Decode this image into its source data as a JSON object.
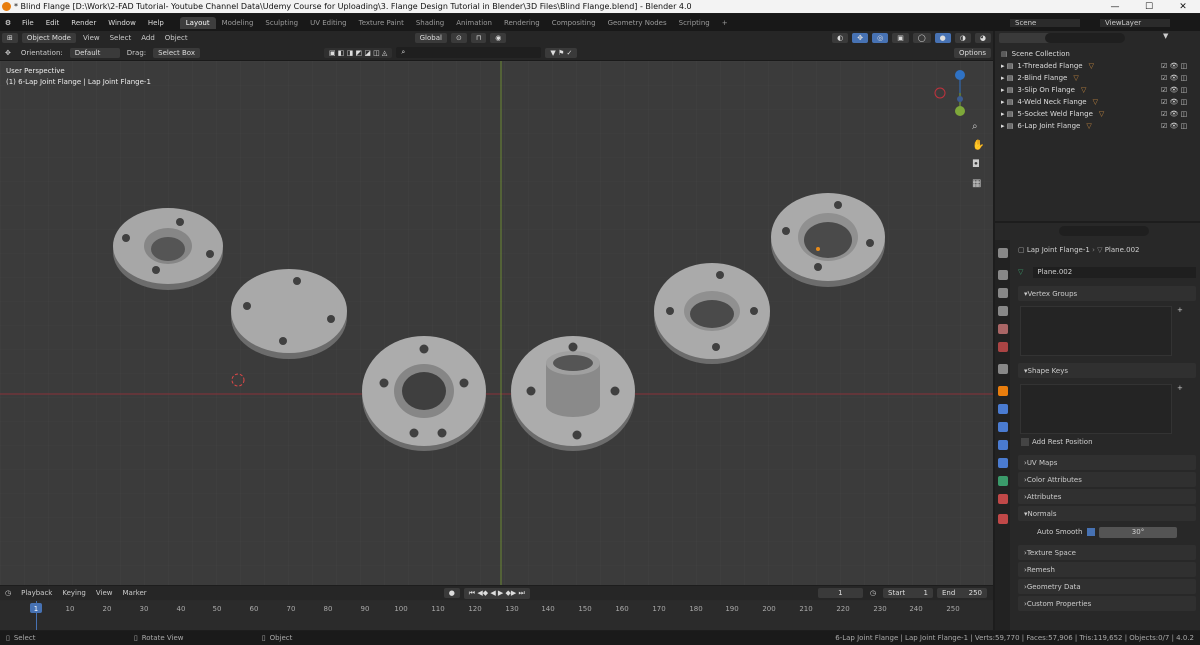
{
  "window": {
    "title": "* Blind Flange [D:\\Work\\2-FAD Tutorial- Youtube Channel Data\\Udemy Course for Uploading\\3. Flange Design Tutorial in Blender\\3D Files\\Blind Flange.blend] - Blender 4.0",
    "min": "—",
    "max": "☐",
    "close": "✕"
  },
  "menu": [
    "File",
    "Edit",
    "Render",
    "Window",
    "Help"
  ],
  "workspaces": [
    "Layout",
    "Modeling",
    "Sculpting",
    "UV Editing",
    "Texture Paint",
    "Shading",
    "Animation",
    "Rendering",
    "Compositing",
    "Geometry Nodes",
    "Scripting",
    "+"
  ],
  "scene": "Scene",
  "view_layer": "ViewLayer",
  "header": {
    "mode": "Object Mode",
    "view": "View",
    "select": "Select",
    "add": "Add",
    "object": "Object",
    "transform": "Global",
    "options": "Options"
  },
  "tool_settings": {
    "orientation_label": "Orientation:",
    "orientation": "Default",
    "drag_label": "Drag:",
    "drag": "Select Box"
  },
  "viewport": {
    "view_name": "User Perspective",
    "object_info": "(1) 6-Lap Joint Flange | Lap Joint Flange-1"
  },
  "outliner": {
    "root": "Scene Collection",
    "items": [
      "1-Threaded Flange",
      "2-Blind Flange",
      "3-Slip On Flange",
      "4-Weld Neck Flange",
      "5-Socket Weld Flange",
      "6-Lap Joint Flange"
    ]
  },
  "properties": {
    "breadcrumb_object": "Lap Joint Flange-1",
    "breadcrumb_mesh": "Plane.002",
    "mesh_name": "Plane.002",
    "vertex_groups": "Vertex Groups",
    "shape_keys": "Shape Keys",
    "add_rest_position": "Add Rest Position",
    "uv_maps": "UV Maps",
    "color_attributes": "Color Attributes",
    "attributes": "Attributes",
    "normals": "Normals",
    "auto_smooth_label": "Auto Smooth",
    "auto_smooth_angle": "30°",
    "texture_space": "Texture Space",
    "remesh": "Remesh",
    "geometry_data": "Geometry Data",
    "custom_properties": "Custom Properties"
  },
  "timeline": {
    "playback": "Playback",
    "keying": "Keying",
    "view": "View",
    "marker": "Marker",
    "current_frame": "1",
    "start_label": "Start",
    "start": "1",
    "end_label": "End",
    "end": "250",
    "ticks": [
      "1",
      "10",
      "20",
      "30",
      "40",
      "50",
      "60",
      "70",
      "80",
      "90",
      "100",
      "110",
      "120",
      "130",
      "140",
      "150",
      "160",
      "170",
      "180",
      "190",
      "200",
      "210",
      "220",
      "230",
      "240",
      "250"
    ]
  },
  "status": {
    "select": "Select",
    "rotate_view": "Rotate View",
    "object": "Object",
    "stats": "6-Lap Joint Flange | Lap Joint Flange-1 | Verts:59,770 | Faces:57,906 | Tris:119,652 | Objects:0/7 | 4.0.2"
  },
  "colors": {
    "accent": "#4772b3",
    "active_tab": "#3d3d3d",
    "x_axis": "#c0323d",
    "y_axis": "#7ea83a",
    "z_axis": "#2f72c4",
    "mesh_icon": "#c78940"
  }
}
